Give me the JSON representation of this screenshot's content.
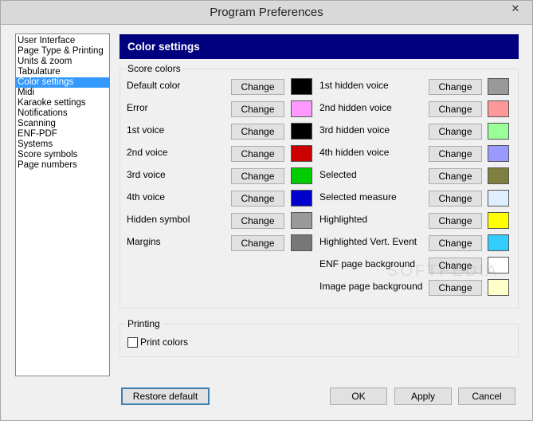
{
  "window": {
    "title": "Program Preferences",
    "close_glyph": "✕"
  },
  "nav": {
    "items": [
      {
        "label": "User Interface",
        "selected": false
      },
      {
        "label": "Page Type & Printing",
        "selected": false
      },
      {
        "label": "Units & zoom",
        "selected": false
      },
      {
        "label": "Tabulature",
        "selected": false
      },
      {
        "label": "Color settings",
        "selected": true
      },
      {
        "label": "Midi",
        "selected": false
      },
      {
        "label": "Karaoke settings",
        "selected": false
      },
      {
        "label": "Notifications",
        "selected": false
      },
      {
        "label": "Scanning",
        "selected": false
      },
      {
        "label": "ENF-PDF",
        "selected": false
      },
      {
        "label": "Systems",
        "selected": false
      },
      {
        "label": "Score symbols",
        "selected": false
      },
      {
        "label": "Page numbers",
        "selected": false
      }
    ]
  },
  "header": {
    "title": "Color settings",
    "bg": "#00007f"
  },
  "score_colors": {
    "label": "Score colors",
    "change_label": "Change",
    "left": [
      {
        "label": "Default color",
        "color": "#000000"
      },
      {
        "label": "Error",
        "color": "#ff99ff"
      },
      {
        "label": "1st voice",
        "color": "#000000"
      },
      {
        "label": "2nd voice",
        "color": "#cc0000"
      },
      {
        "label": "3rd voice",
        "color": "#00cc00"
      },
      {
        "label": "4th voice",
        "color": "#0000cc"
      },
      {
        "label": "Hidden symbol",
        "color": "#999999"
      },
      {
        "label": "Margins",
        "color": "#777777"
      }
    ],
    "right": [
      {
        "label": "1st hidden voice",
        "color": "#999999"
      },
      {
        "label": "2nd hidden voice",
        "color": "#ff9999"
      },
      {
        "label": "3rd hidden voice",
        "color": "#99ff99"
      },
      {
        "label": "4th hidden voice",
        "color": "#9999ff"
      },
      {
        "label": "Selected",
        "color": "#7f7f3f"
      },
      {
        "label": "Selected measure",
        "color": "#dfefff"
      },
      {
        "label": "Highlighted",
        "color": "#ffff00"
      },
      {
        "label": "Highlighted Vert. Event",
        "color": "#33ccff"
      },
      {
        "label": "ENF page background",
        "color": "#ffffff"
      },
      {
        "label": "Image page background",
        "color": "#ffffcc"
      }
    ]
  },
  "printing": {
    "label": "Printing",
    "print_colors_label": "Print colors",
    "print_colors_checked": false
  },
  "buttons": {
    "restore_default": "Restore default",
    "ok": "OK",
    "apply": "Apply",
    "cancel": "Cancel"
  },
  "watermark": "SOFTPEDIA"
}
